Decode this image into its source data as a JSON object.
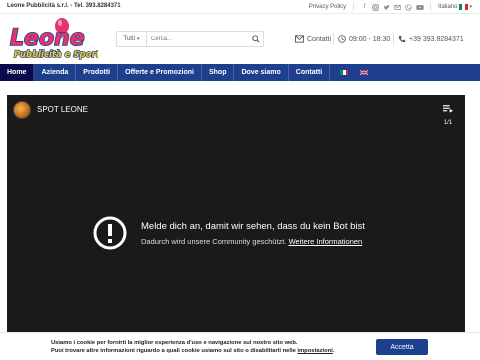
{
  "topbar": {
    "company": "Leone Pubblicità s.r.l. - Tel. 393.8284371",
    "privacy": "Privacy Policy",
    "language": "Italiano",
    "social_icons": [
      "facebook-icon",
      "instagram-icon",
      "twitter-icon",
      "email-icon",
      "phone-icon",
      "youtube-icon"
    ]
  },
  "logo": {
    "brand": "Leone",
    "tagline": "Pubblicità e Sport"
  },
  "search": {
    "category": "Tutti",
    "placeholder": "Cerca..."
  },
  "header": {
    "contacts": "Contatti",
    "hours": "09:00 - 18:30",
    "phone": "+39 393.8284371"
  },
  "nav": {
    "items": [
      "Home",
      "Azienda",
      "Prodotti",
      "Offerte e Promozioni",
      "Shop",
      "Dove siamo",
      "Contatti"
    ],
    "active": "Home"
  },
  "video": {
    "channel_title": "SPOT LEONE",
    "playlist_count": "1/1",
    "message": "Melde dich an, damit wir sehen, dass du kein Bot bist",
    "sub_message": "Dadurch wird unsere Community geschützt.",
    "more_info": "Weitere Informationen"
  },
  "cookie": {
    "line1": "Usiamo i cookie per fornirti la miglior esperienza d'uso e navigazione sul nostro sito web.",
    "line2": "Puoi trovare altre informazioni riguardo a quali cookie usiamo sul sito o disabilitarli nelle ",
    "link": "impostazioni",
    "button": "Accetta"
  },
  "colors": {
    "nav_bg": "#1e3f8e",
    "nav_active": "#0a0a4d",
    "accept_bg": "#1e3f8e"
  }
}
